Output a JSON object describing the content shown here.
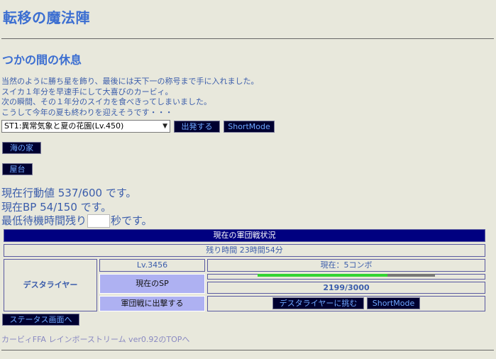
{
  "header": {
    "title": "転移の魔法陣"
  },
  "place": {
    "title": "つかの間の休息"
  },
  "story": {
    "lines": [
      "当然のように勝ち星を飾り、最後には天下一の称号まで手に入れました。",
      "スイカ１年分を早速手にして大喜びのカービィ。",
      "次の瞬間、その１年分のスイカを食べきってしまいました。",
      "こうして今年の夏も終わりを迎えそうです・・・"
    ]
  },
  "stage": {
    "selected": "ST1:異常気象と夏の花園(Lv.450)",
    "depart_label": "出発する",
    "shortmode_label": "ShortMode"
  },
  "links": {
    "umi": "海の家",
    "yatai": "屋台"
  },
  "status": {
    "action": "現在行動値 537/600 です。",
    "bp": "現在BP 54/150 です。",
    "wait_prefix": "最低待機時間残り",
    "wait_suffix": "秒です。"
  },
  "battle": {
    "header": "現在の軍団戦状況",
    "time_left": "残り時間 23時間54分",
    "boss_name": "デスタライヤー",
    "level": "Lv.3456",
    "combo": "現在：5コンボ",
    "sp_label": "現在のSP",
    "sp_value": "2199/3000",
    "sp_fraction": 0.733,
    "join_label": "軍団戦に出撃する",
    "challenge_label": "デスタライヤーに挑む",
    "shortmode_label": "ShortMode"
  },
  "status_link": "ステータス画面へ",
  "footer": "カービィFFA レインボーストリーム ver0.92のTOPへ"
}
